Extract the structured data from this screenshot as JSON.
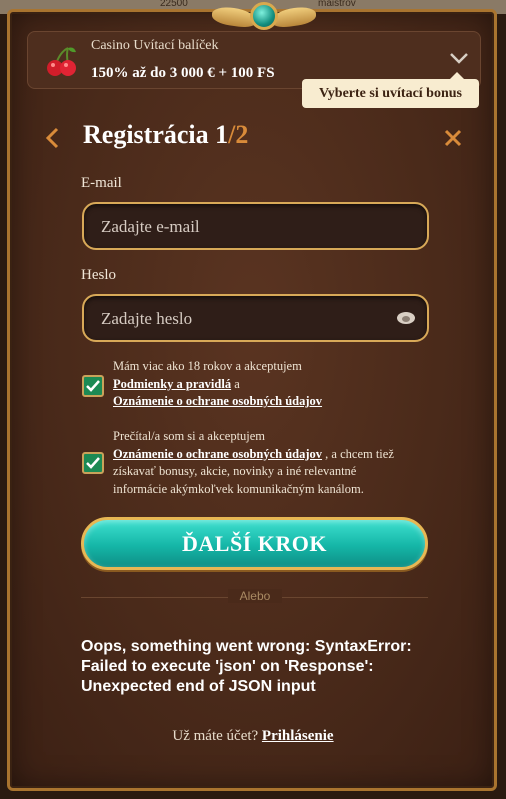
{
  "background": {
    "left_text": "22500",
    "right_text": "maistrov"
  },
  "bonus": {
    "title": "Casino Uvítací balíček",
    "description": "150% až do 3 000 € + 100 FS",
    "tooltip": "Vyberte si uvítací bonus"
  },
  "header": {
    "title": "Registrácia 1",
    "step": "/2"
  },
  "form": {
    "email_label": "E-mail",
    "email_placeholder": "Zadajte e-mail",
    "email_value": "",
    "password_label": "Heslo",
    "password_placeholder": "Zadajte heslo",
    "password_value": ""
  },
  "consents": {
    "age": {
      "text": "Mám viac ako 18 rokov a akceptujem",
      "link1": "Podmienky a pravidlá",
      "and": " a",
      "link2": "Oznámenie o ochrane osobných údajov",
      "checked": true
    },
    "marketing": {
      "text": "Prečítal/a som si a akceptujem",
      "link": "Oznámenie o ochrane osobných údajov",
      "rest": " , a chcem tiež získavať bonusy, akcie, novinky a iné relevantné informácie akýmkoľvek komunikačným kanálom.",
      "checked": true
    }
  },
  "next_button": "ĎALŠÍ KROK",
  "divider_text": "Alebo",
  "error_message": "Oops, something went wrong: SyntaxError: Failed to execute 'json' on 'Response': Unexpected end of JSON input",
  "footer": {
    "question": "Už máte účet? ",
    "login_link": "Prihlásenie"
  },
  "colors": {
    "accent": "#d98b3a",
    "button": "#15b6a7",
    "border": "#d8a958",
    "checkbox": "#1c8a54"
  }
}
